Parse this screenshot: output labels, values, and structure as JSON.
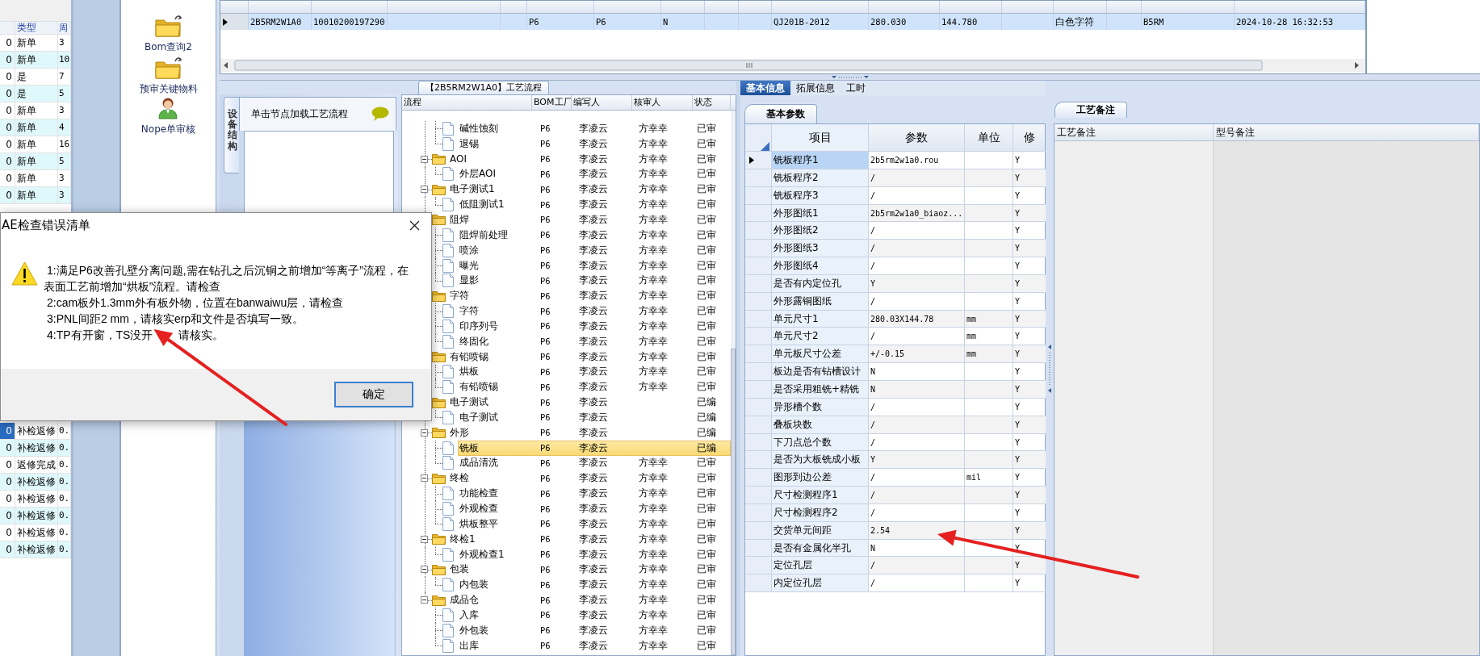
{
  "left_table": {
    "columns": [
      "类型",
      "周"
    ],
    "rows_top": [
      {
        "column_1": "0",
        "type": "新单",
        "week": "3",
        "selected": false
      },
      {
        "column_1": "0",
        "type": "新单",
        "week": "10",
        "selected": false
      },
      {
        "column_1": "0",
        "type": "是",
        "week": "7",
        "selected": false
      },
      {
        "column_1": "0",
        "type": "是",
        "week": "5",
        "selected": false
      },
      {
        "column_1": "0",
        "type": "新单",
        "week": "3",
        "selected": false
      },
      {
        "column_1": "0",
        "type": "新单",
        "week": "4",
        "selected": false
      },
      {
        "column_1": "0",
        "type": "新单",
        "week": "16",
        "selected": false
      },
      {
        "column_1": "0",
        "type": "新单",
        "week": "5",
        "selected": false
      },
      {
        "column_1": "0",
        "type": "新单",
        "week": "3",
        "selected": false
      },
      {
        "column_1": "0",
        "type": "新单",
        "week": "3",
        "selected": false
      }
    ],
    "rows_bottom": [
      {
        "column_1": "0",
        "type": "补检返修",
        "week": "0.",
        "selected": true
      },
      {
        "column_1": "0",
        "type": "补检返修",
        "week": "0.",
        "selected": false
      },
      {
        "column_1": "0",
        "type": "返修完成",
        "week": "0.",
        "selected": false
      },
      {
        "column_1": "0",
        "type": "补检返修",
        "week": "0.",
        "selected": false
      },
      {
        "column_1": "0",
        "type": "补检返修",
        "week": "0.",
        "selected": false
      },
      {
        "column_1": "0",
        "type": "补检返修",
        "week": "0.",
        "selected": false
      },
      {
        "column_1": "0",
        "type": "补检返修",
        "week": "0.",
        "selected": false
      },
      {
        "column_1": "0",
        "type": "补检返修",
        "week": "0.",
        "selected": false
      }
    ]
  },
  "shortcuts": [
    {
      "label": "Bom查询2",
      "kind": "folder"
    },
    {
      "label": "预审关键物料",
      "kind": "folder"
    },
    {
      "label": "Nope单审核",
      "kind": "person"
    }
  ],
  "top_grid": {
    "rows": [
      {
        "selected": true,
        "column_1": "2B5RM2W1A0",
        "column_2": "10010200197290",
        "column_5": "P6",
        "column_6": "P6",
        "column_7": "N",
        "column_10": "QJ201B-2012",
        "column_11": "280.030",
        "column_12": "144.780",
        "column_14": "白色字符",
        "column_16": "B5RM",
        "column_17": "2024-10-28 16:32:53"
      }
    ]
  },
  "flow_tab": {
    "label": "【2B5RM2W1A0】工艺流程",
    "selected": true
  },
  "structure_panel": {
    "tab": {
      "label": "设备结构",
      "selected": true
    },
    "hint": "单击节点加载工艺流程"
  },
  "tree": {
    "columns": [
      "流程",
      "BOM工厂",
      "编写人",
      "核审人",
      "状态"
    ],
    "nodes": [
      {
        "children": [
          {
            "label": "碱性蚀刻",
            "bom": "P6",
            "writer": "李凌云",
            "reviewer": "方幸幸",
            "status": "已审",
            "selected": false
          },
          {
            "label": "退锡",
            "bom": "P6",
            "writer": "李凌云",
            "reviewer": "方幸幸",
            "status": "已审",
            "selected": false
          }
        ]
      },
      {
        "label": "AOI",
        "bom": "P6",
        "writer": "李凌云",
        "reviewer": "方幸幸",
        "status": "已审",
        "selected": false,
        "expanded": true,
        "children": [
          {
            "label": "外层AOI",
            "bom": "P6",
            "writer": "李凌云",
            "reviewer": "方幸幸",
            "status": "已审",
            "selected": false
          }
        ]
      },
      {
        "label": "电子测试1",
        "bom": "P6",
        "writer": "李凌云",
        "reviewer": "方幸幸",
        "status": "已审",
        "selected": false,
        "expanded": true,
        "children": [
          {
            "label": "低阻测试1",
            "bom": "P6",
            "writer": "李凌云",
            "reviewer": "方幸幸",
            "status": "已审",
            "selected": false
          }
        ]
      },
      {
        "label": "阻焊",
        "bom": "P6",
        "writer": "李凌云",
        "reviewer": "方幸幸",
        "status": "已审",
        "selected": false,
        "children": [
          {
            "label": "阻焊前处理",
            "bom": "P6",
            "writer": "李凌云",
            "reviewer": "方幸幸",
            "status": "已审",
            "selected": false
          },
          {
            "label": "喷涂",
            "bom": "P6",
            "writer": "李凌云",
            "reviewer": "方幸幸",
            "status": "已审",
            "selected": false
          },
          {
            "label": "曝光",
            "bom": "P6",
            "writer": "李凌云",
            "reviewer": "方幸幸",
            "status": "已审",
            "selected": false
          },
          {
            "label": "显影",
            "bom": "P6",
            "writer": "李凌云",
            "reviewer": "方幸幸",
            "status": "已审",
            "selected": false
          }
        ]
      },
      {
        "label": "字符",
        "bom": "P6",
        "writer": "李凌云",
        "reviewer": "方幸幸",
        "status": "已审",
        "selected": false,
        "children": [
          {
            "label": "字符",
            "bom": "P6",
            "writer": "李凌云",
            "reviewer": "方幸幸",
            "status": "已审",
            "selected": false
          },
          {
            "label": "印序列号",
            "bom": "P6",
            "writer": "李凌云",
            "reviewer": "方幸幸",
            "status": "已审",
            "selected": false
          },
          {
            "label": "终固化",
            "bom": "P6",
            "writer": "李凌云",
            "reviewer": "方幸幸",
            "status": "已审",
            "selected": false
          }
        ]
      },
      {
        "label": "有铅喷锡",
        "bom": "P6",
        "writer": "李凌云",
        "reviewer": "方幸幸",
        "status": "已审",
        "selected": false,
        "children": [
          {
            "label": "烘板",
            "bom": "P6",
            "writer": "李凌云",
            "reviewer": "方幸幸",
            "status": "已审",
            "selected": false
          },
          {
            "label": "有铅喷锡",
            "bom": "P6",
            "writer": "李凌云",
            "reviewer": "方幸幸",
            "status": "已审",
            "selected": false
          }
        ]
      },
      {
        "label": "电子测试",
        "bom": "P6",
        "writer": "李凌云",
        "status": "已编",
        "selected": false,
        "children": [
          {
            "label": "电子测试",
            "bom": "P6",
            "writer": "李凌云",
            "status": "已编",
            "selected": false
          }
        ]
      },
      {
        "label": "外形",
        "bom": "P6",
        "writer": "李凌云",
        "status": "已编",
        "selected": false,
        "expanded": true,
        "children": [
          {
            "label": "铣板",
            "bom": "P6",
            "writer": "李凌云",
            "status": "已编",
            "selected": true
          },
          {
            "label": "成品清洗",
            "bom": "P6",
            "writer": "李凌云",
            "reviewer": "方幸幸",
            "status": "已审",
            "selected": false
          }
        ]
      },
      {
        "label": "终检",
        "bom": "P6",
        "writer": "李凌云",
        "reviewer": "方幸幸",
        "status": "已审",
        "selected": false,
        "expanded": true,
        "children": [
          {
            "label": "功能检查",
            "bom": "P6",
            "writer": "李凌云",
            "reviewer": "方幸幸",
            "status": "已审",
            "selected": false
          },
          {
            "label": "外观检查",
            "bom": "P6",
            "writer": "李凌云",
            "reviewer": "方幸幸",
            "status": "已审",
            "selected": false
          },
          {
            "label": "烘板整平",
            "bom": "P6",
            "writer": "李凌云",
            "reviewer": "方幸幸",
            "status": "已审",
            "selected": false
          }
        ]
      },
      {
        "label": "终检1",
        "bom": "P6",
        "writer": "李凌云",
        "reviewer": "方幸幸",
        "status": "已审",
        "selected": false,
        "expanded": true,
        "children": [
          {
            "label": "外观检查1",
            "bom": "P6",
            "writer": "李凌云",
            "reviewer": "方幸幸",
            "status": "已审",
            "selected": false
          }
        ]
      },
      {
        "label": "包装",
        "bom": "P6",
        "writer": "李凌云",
        "reviewer": "方幸幸",
        "status": "已审",
        "selected": false,
        "expanded": true,
        "children": [
          {
            "label": "内包装",
            "bom": "P6",
            "writer": "李凌云",
            "reviewer": "方幸幸",
            "status": "已审",
            "selected": false
          }
        ]
      },
      {
        "label": "成品仓",
        "bom": "P6",
        "writer": "李凌云",
        "reviewer": "方幸幸",
        "status": "已审",
        "selected": false,
        "expanded": true,
        "children": [
          {
            "label": "入库",
            "bom": "P6",
            "writer": "李凌云",
            "reviewer": "方幸幸",
            "status": "已审",
            "selected": false
          },
          {
            "label": "外包装",
            "bom": "P6",
            "writer": "李凌云",
            "reviewer": "方幸幸",
            "status": "已审",
            "selected": false
          },
          {
            "label": "出库",
            "bom": "P6",
            "writer": "李凌云",
            "reviewer": "方幸幸",
            "status": "已审",
            "selected": false
          }
        ]
      }
    ]
  },
  "info_tabs": [
    {
      "label": "基本信息",
      "selected": true
    },
    {
      "label": "拓展信息",
      "selected": false
    },
    {
      "label": "工时",
      "selected": false
    }
  ],
  "param_tab": {
    "label": "基本参数",
    "selected": true
  },
  "parameters": {
    "columns": [
      "项目",
      "参数",
      "单位",
      "修"
    ],
    "rows": [
      {
        "item": "铣板程序1",
        "value": "2b5rm2w1a0.rou",
        "modified": "Y",
        "selected": true
      },
      {
        "item": "铣板程序2",
        "value": "/",
        "modified": "Y",
        "selected": false
      },
      {
        "item": "铣板程序3",
        "value": "/",
        "modified": "Y",
        "selected": false
      },
      {
        "item": "外形图纸1",
        "value": "2b5rm2w1a0_biaoz...",
        "modified": "Y",
        "selected": false
      },
      {
        "item": "外形图纸2",
        "value": "/",
        "modified": "Y",
        "selected": false
      },
      {
        "item": "外形图纸3",
        "value": "/",
        "modified": "Y",
        "selected": false
      },
      {
        "item": "外形图纸4",
        "value": "/",
        "modified": "Y",
        "selected": false
      },
      {
        "item": "是否有内定位孔",
        "value": "Y",
        "modified": "Y",
        "selected": false
      },
      {
        "item": "外形露铜图纸",
        "value": "/",
        "modified": "Y",
        "selected": false
      },
      {
        "item": "单元尺寸1",
        "value": "280.03X144.78",
        "unit": "mm",
        "modified": "Y",
        "selected": false
      },
      {
        "item": "单元尺寸2",
        "value": "/",
        "unit": "mm",
        "modified": "Y",
        "selected": false
      },
      {
        "item": "单元板尺寸公差",
        "value": "+/-0.15",
        "unit": "mm",
        "modified": "Y",
        "selected": false
      },
      {
        "item": "板边是否有钻槽设计",
        "value": "N",
        "modified": "Y",
        "selected": false
      },
      {
        "item": "是否采用粗铣+精铣",
        "value": "N",
        "modified": "Y",
        "selected": false
      },
      {
        "item": "异形槽个数",
        "value": "/",
        "modified": "Y",
        "selected": false
      },
      {
        "item": "叠板块数",
        "value": "/",
        "modified": "Y",
        "selected": false
      },
      {
        "item": "下刀点总个数",
        "value": "/",
        "modified": "Y",
        "selected": false
      },
      {
        "item": "是否为大板铣成小板",
        "value": "Y",
        "modified": "Y",
        "selected": false
      },
      {
        "item": "图形到边公差",
        "value": "/",
        "unit": "mil",
        "modified": "Y",
        "selected": false
      },
      {
        "item": "尺寸检测程序1",
        "value": "/",
        "modified": "Y",
        "selected": false
      },
      {
        "item": "尺寸检测程序2",
        "value": "/",
        "modified": "Y",
        "selected": false
      },
      {
        "item": "交货单元间距",
        "value": "2.54",
        "modified": "Y",
        "selected": false
      },
      {
        "item": "是否有金属化半孔",
        "value": "N",
        "modified": "Y",
        "selected": false
      },
      {
        "item": "定位孔层",
        "value": "/",
        "modified": "Y",
        "selected": false
      },
      {
        "item": "内定位孔层",
        "value": "/",
        "modified": "Y",
        "selected": false
      }
    ]
  },
  "remarks": {
    "tab": {
      "label": "工艺备注",
      "selected": true
    },
    "columns": [
      "工艺备注",
      "型号备注"
    ]
  },
  "dialog": {
    "title": "AE检查错误清单",
    "messages": [
      {
        "text": "1:满足P6改善孔壁分离问题,需在钻孔之后沉铜之前增加“等离子”流程，在表面工艺前增加“烘板”流程。请检查"
      },
      {
        "text": "2:cam板外1.3mm外有板外物，位置在banwaiwu层，请检查"
      },
      {
        "text": "3:PNL间距2 mm，请核实erp和文件是否填写一致。"
      },
      {
        "parts": [
          "4:TP有开窗，TS没开",
          "请核实。"
        ]
      }
    ],
    "ok_button": "确定"
  }
}
